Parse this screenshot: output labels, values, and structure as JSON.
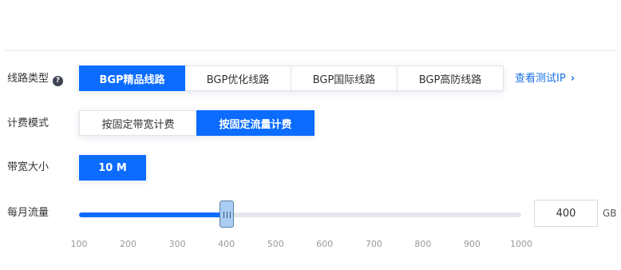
{
  "form": {
    "line_type": {
      "label": "线路类型",
      "help_glyph": "?",
      "options": [
        "BGP精品线路",
        "BGP优化线路",
        "BGP国际线路",
        "BGP高防线路"
      ],
      "selected_index": 0,
      "test_ip_link": "查看测试IP",
      "link_chevron": "›"
    },
    "billing_mode": {
      "label": "计费模式",
      "options": [
        "按固定带宽计费",
        "按固定流量计费"
      ],
      "selected_index": 1
    },
    "bandwidth": {
      "label": "带宽大小",
      "value": "10 M"
    },
    "monthly_traffic": {
      "label": "每月流量",
      "value": "400",
      "unit": "GB",
      "slider": {
        "min": 100,
        "max": 1000,
        "value": 400,
        "ticks": [
          "100",
          "200",
          "300",
          "400",
          "500",
          "600",
          "700",
          "800",
          "900",
          "1000"
        ]
      }
    }
  },
  "colors": {
    "accent": "#0b6cff",
    "link": "#1a6fe6",
    "track": "#e4e7ec",
    "thumb": "#a9cdf3"
  }
}
